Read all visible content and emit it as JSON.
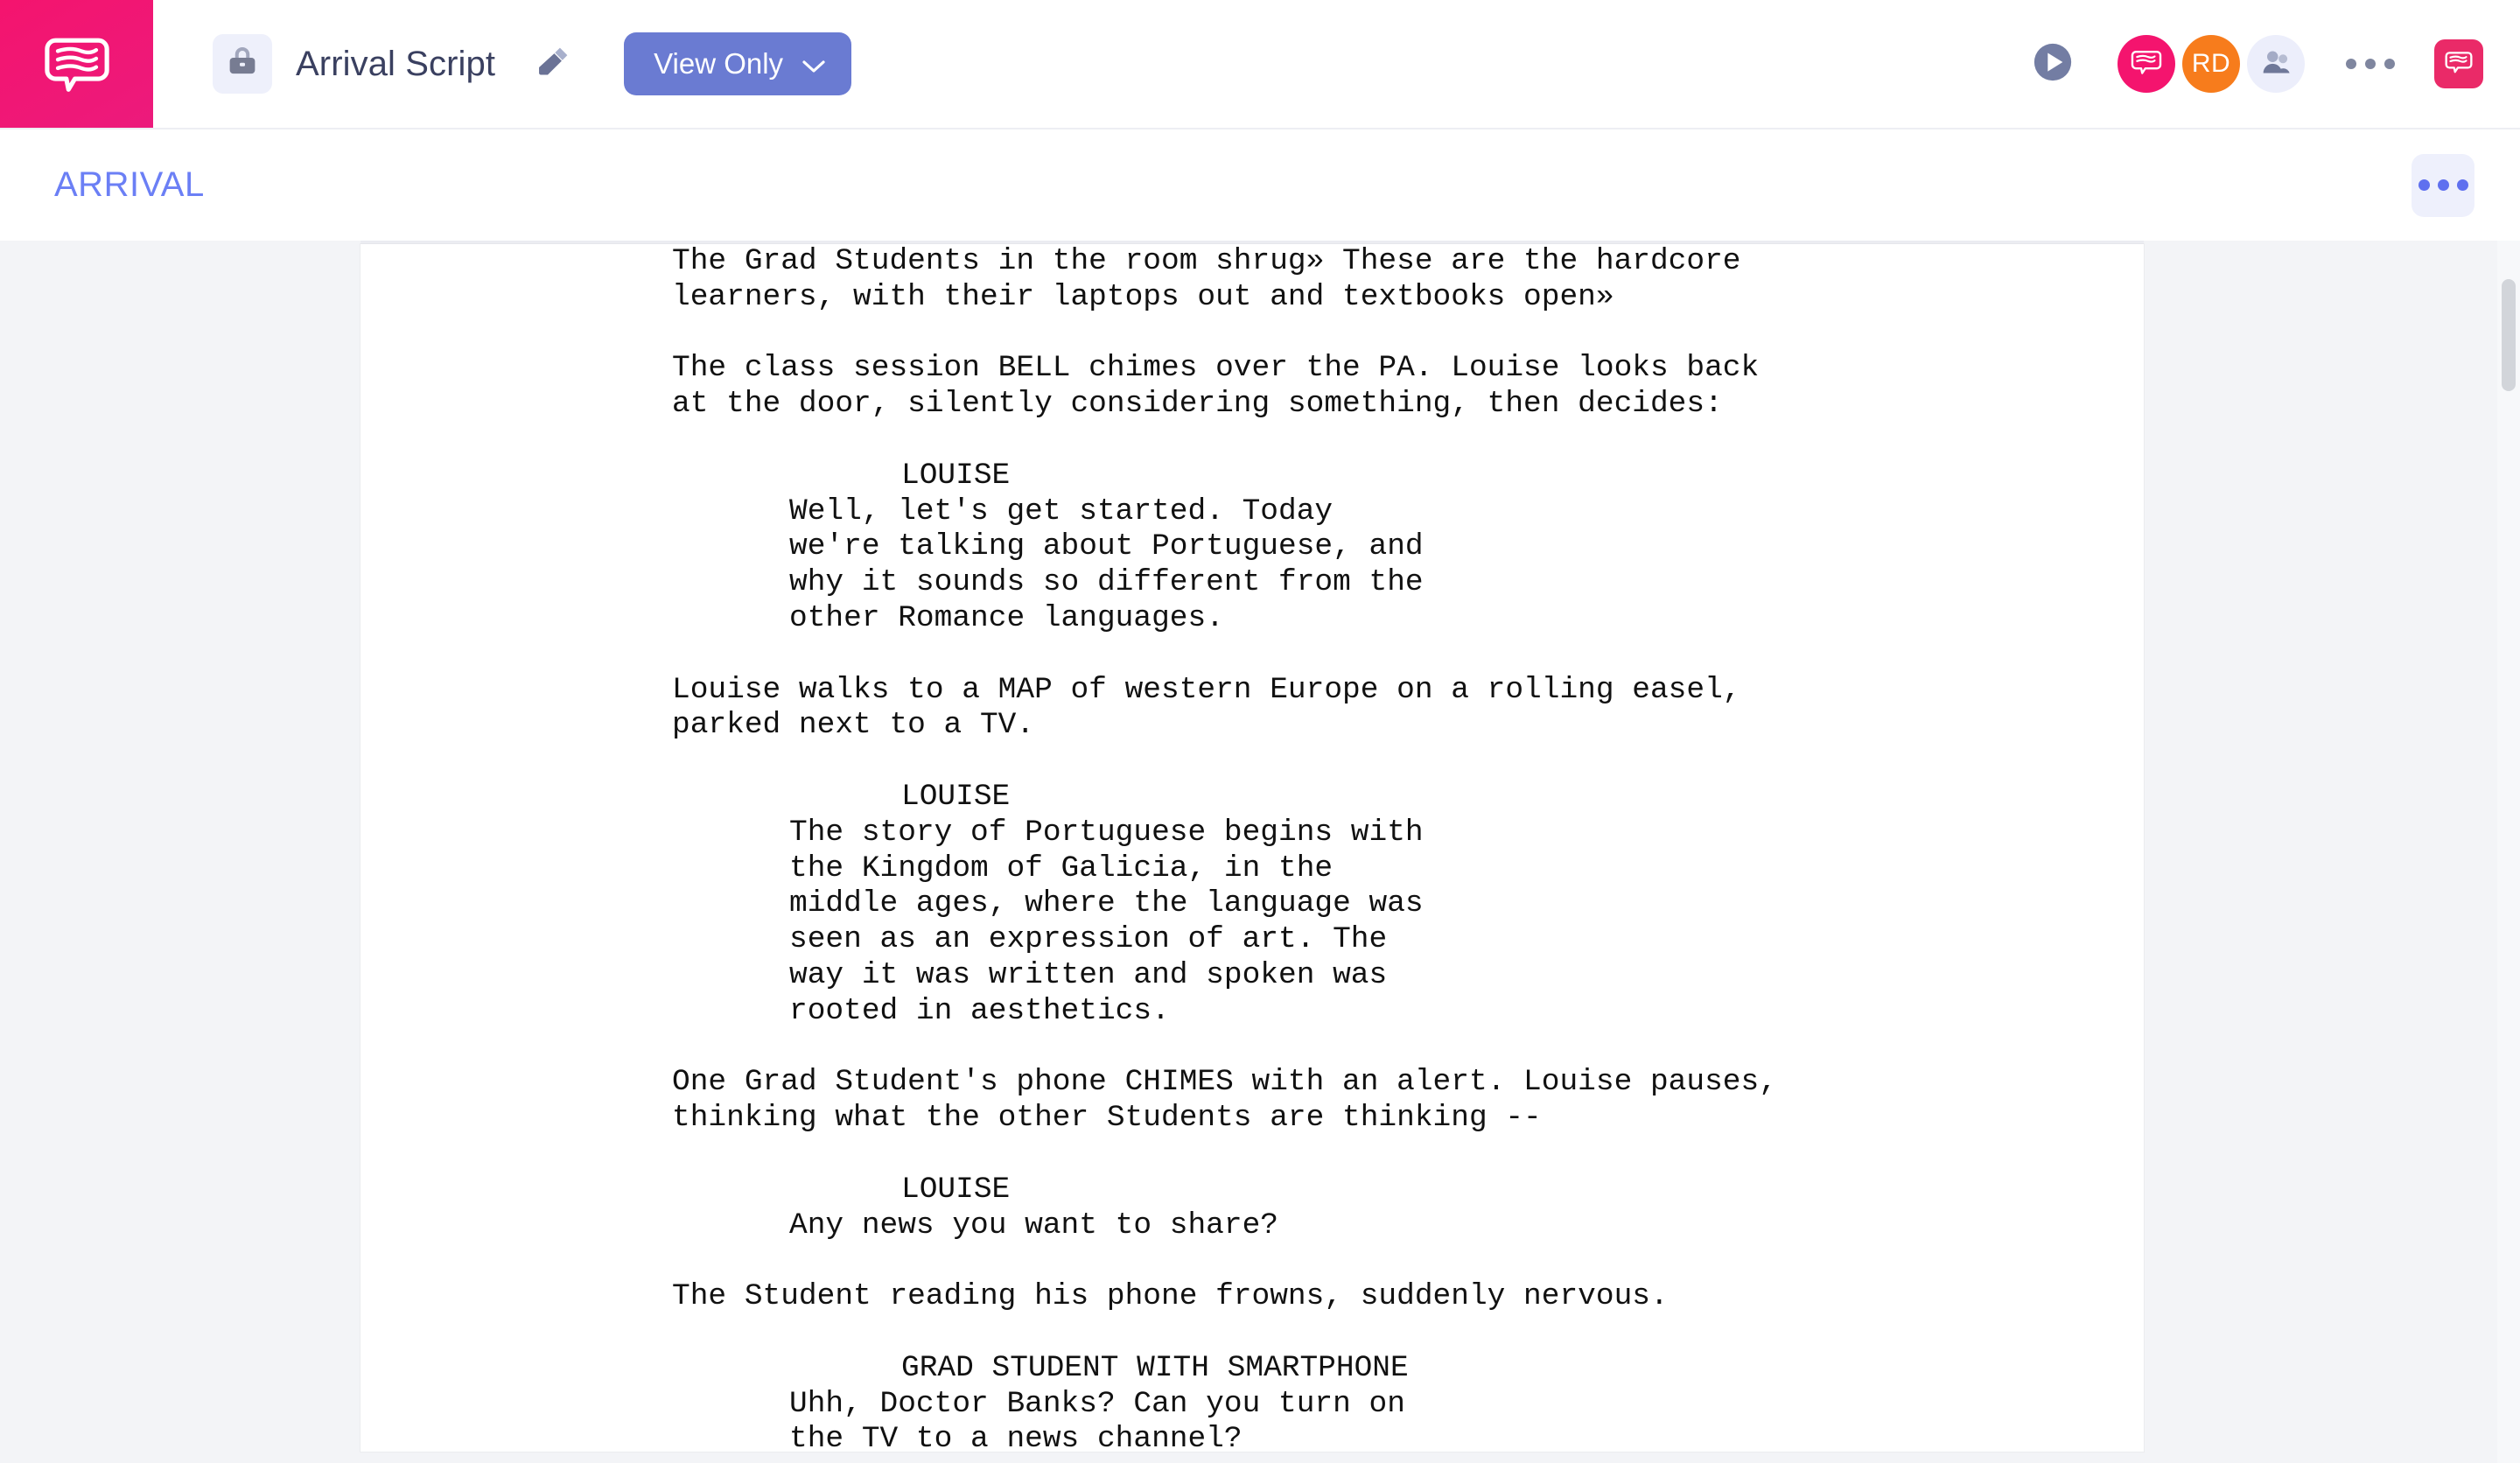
{
  "app": {
    "brand_color": "#f4146e",
    "accent_color": "#6a7bd2",
    "script_title_color": "#6b7ff5"
  },
  "topbar": {
    "logo_icon": "speech-bubble-logo-icon",
    "document_icon": "briefcase-icon",
    "document_title": "Arrival Script",
    "edit_icon": "pencil-icon",
    "permission_button": {
      "label": "View Only",
      "chevron_icon": "chevron-down-icon"
    },
    "play_icon": "play-circle-icon",
    "avatars": [
      {
        "type": "logo",
        "icon": "speech-bubble-logo-icon",
        "color": "#f4146e"
      },
      {
        "type": "initials",
        "initials": "RD",
        "color": "#f77c1c"
      },
      {
        "type": "people",
        "icon": "people-icon",
        "color": "#eceefb"
      }
    ],
    "more_menu_icon": "three-dots-icon",
    "app_badge_icon": "speech-bubble-logo-icon"
  },
  "subbar": {
    "script_name": "ARRIVAL",
    "more_menu_icon": "three-dots-icon"
  },
  "script": {
    "blocks": [
      {
        "type": "action",
        "text": "The Grad Students in the room shrug» These are the hardcore"
      },
      {
        "type": "action",
        "text": "learners, with their laptops out and textbooks open»"
      },
      {
        "type": "spacer",
        "text": ""
      },
      {
        "type": "action",
        "text": "The class session BELL chimes over the PA. Louise looks back"
      },
      {
        "type": "action",
        "text": "at the door, silently considering something, then decides:"
      },
      {
        "type": "spacer",
        "text": ""
      },
      {
        "type": "charname",
        "text": "LOUISE"
      },
      {
        "type": "dialogue",
        "text": "Well, let's get started. Today"
      },
      {
        "type": "dialogue",
        "text": "we're talking about Portuguese, and"
      },
      {
        "type": "dialogue",
        "text": "why it sounds so different from the"
      },
      {
        "type": "dialogue",
        "text": "other Romance languages."
      },
      {
        "type": "spacer",
        "text": ""
      },
      {
        "type": "action",
        "text": "Louise walks to a MAP of western Europe on a rolling easel,"
      },
      {
        "type": "action",
        "text": "parked next to a TV."
      },
      {
        "type": "spacer",
        "text": ""
      },
      {
        "type": "charname",
        "text": "LOUISE"
      },
      {
        "type": "dialogue",
        "text": "The story of Portuguese begins with"
      },
      {
        "type": "dialogue",
        "text": "the Kingdom of Galicia, in the"
      },
      {
        "type": "dialogue",
        "text": "middle ages, where the language was"
      },
      {
        "type": "dialogue",
        "text": "seen as an expression of art. The"
      },
      {
        "type": "dialogue",
        "text": "way it was written and spoken was"
      },
      {
        "type": "dialogue",
        "text": "rooted in aesthetics."
      },
      {
        "type": "spacer",
        "text": ""
      },
      {
        "type": "action",
        "text": "One Grad Student's phone CHIMES with an alert. Louise pauses,"
      },
      {
        "type": "action",
        "text": "thinking what the other Students are thinking --"
      },
      {
        "type": "spacer",
        "text": ""
      },
      {
        "type": "charname",
        "text": "LOUISE"
      },
      {
        "type": "dialogue",
        "text": "Any news you want to share?"
      },
      {
        "type": "spacer",
        "text": ""
      },
      {
        "type": "action",
        "text": "The Student reading his phone frowns, suddenly nervous."
      },
      {
        "type": "spacer",
        "text": ""
      },
      {
        "type": "charname",
        "text": "GRAD STUDENT WITH SMARTPHONE"
      },
      {
        "type": "dialogue",
        "text": "Uhh, Doctor Banks? Can you turn on"
      },
      {
        "type": "dialogue",
        "text": "the TV to a news channel?"
      }
    ]
  },
  "scrollbar": {
    "orientation": "vertical"
  }
}
